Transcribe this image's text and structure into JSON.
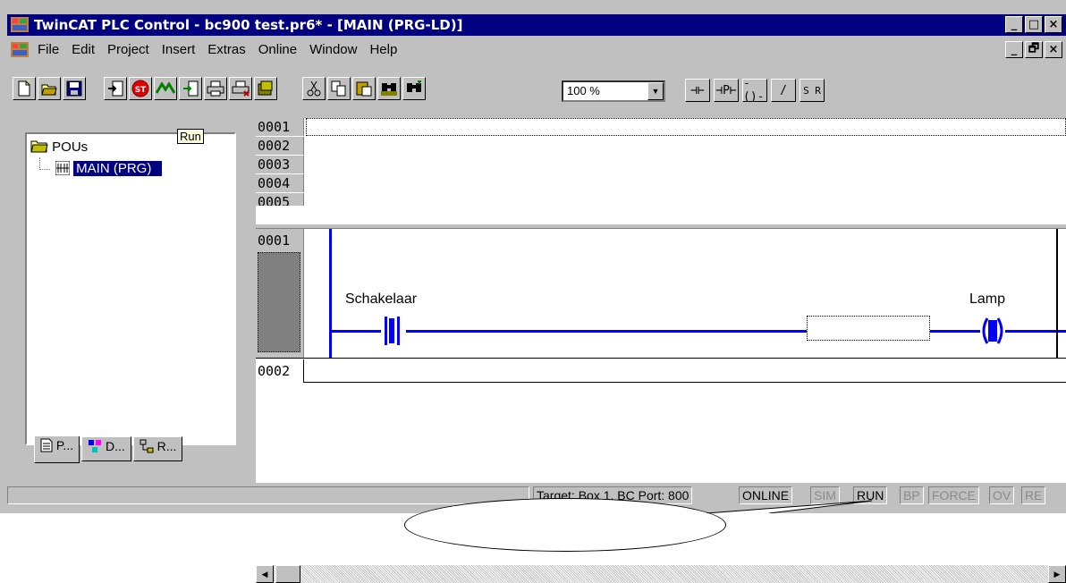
{
  "window": {
    "title": "TwinCAT PLC Control - bc900 test.pr6* - [MAIN (PRG-LD)]",
    "caption_buttons": [
      "_",
      "□",
      "×"
    ],
    "mdi_buttons": [
      "_",
      "🗗",
      "×"
    ]
  },
  "menu": {
    "items": [
      "File",
      "Edit",
      "Project",
      "Insert",
      "Extras",
      "Online",
      "Window",
      "Help"
    ]
  },
  "toolbar": {
    "zoom": "100 %",
    "ld_buttons": [
      "⊣⊢",
      "⊣P⊢",
      "-()-",
      "/",
      "S R"
    ]
  },
  "tree": {
    "root": "POUs",
    "child": "MAIN (PRG)",
    "tooltip": "Run"
  },
  "tabs": [
    "P...",
    "D...",
    "R..."
  ],
  "declaration": {
    "lines": [
      "0001",
      "0002",
      "0003",
      "0004",
      "0005"
    ]
  },
  "ladder": {
    "network1": "0001",
    "network2": "0002",
    "contact_label": "Schakelaar",
    "coil_label": "Lamp"
  },
  "status": {
    "target": "Target: Box 1, BC Port: 800",
    "online": "ONLINE",
    "sim": "SIM",
    "run": "RUN",
    "bp": "BP",
    "force": "FORCE",
    "ov": "OV",
    "re": "RE"
  },
  "colors": {
    "titlebar": "#000080",
    "wire": "#0000ff",
    "selection": "#000080"
  }
}
